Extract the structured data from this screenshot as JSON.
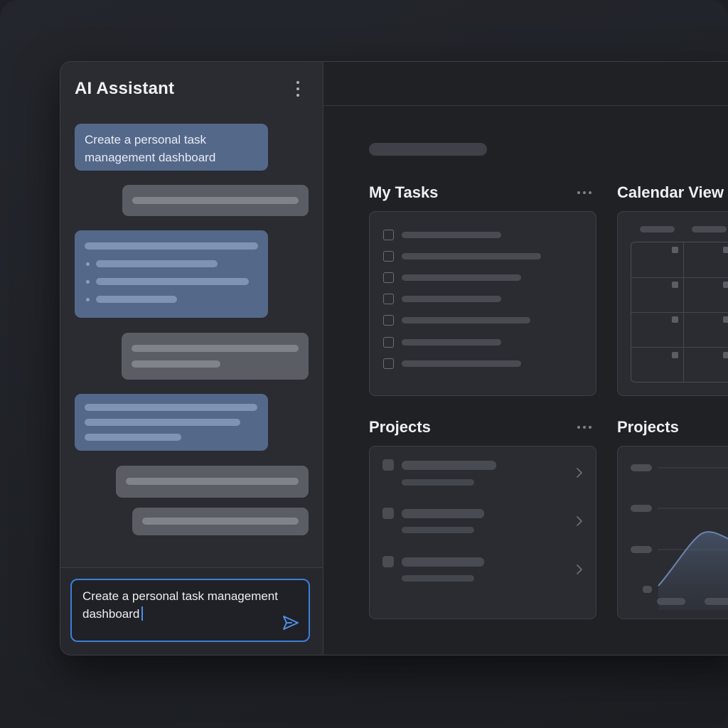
{
  "sidebar": {
    "title": "AI Assistant",
    "menu_icon": "kebab-menu-icon",
    "first_message": "Create a personal task management dashboard",
    "input": {
      "value": "Create a personal task management dashboard",
      "send_icon": "send-icon"
    }
  },
  "main": {
    "cards": [
      {
        "title": "My Tasks",
        "menu_icon": "more-horizontal-icon"
      },
      {
        "title": "Calendar View"
      },
      {
        "title": "Projects",
        "menu_icon": "more-horizontal-icon"
      },
      {
        "title": "Projects"
      }
    ]
  },
  "colors": {
    "accent": "#3d7fd9",
    "user_bubble": "#54688a",
    "ai_bubble": "#5a5d64",
    "background": "#1e2026",
    "card": "#2a2c31"
  }
}
